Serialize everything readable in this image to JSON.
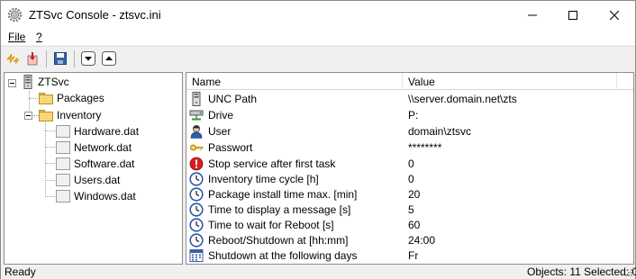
{
  "window": {
    "title": "ZTSvc Console - ztsvc.ini",
    "icon": "gear-cog-icon"
  },
  "menu": {
    "file_label": "File",
    "help_label": "?"
  },
  "toolbar": {
    "buttons": [
      "lightning-icon",
      "import-icon",
      "save-icon",
      "arrow-down-icon",
      "arrow-up-icon"
    ]
  },
  "tree": {
    "root": "ZTSvc",
    "packages": "Packages",
    "inventory": "Inventory",
    "files": [
      "Hardware.dat",
      "Network.dat",
      "Software.dat",
      "Users.dat",
      "Windows.dat"
    ]
  },
  "list": {
    "col_name": "Name",
    "col_value": "Value",
    "rows": [
      {
        "name": "UNC Path",
        "value": "\\\\server.domain.net\\zts",
        "icon": "server-icon"
      },
      {
        "name": "Drive",
        "value": "P:",
        "icon": "network-drive-icon"
      },
      {
        "name": "User",
        "value": "domain\\ztsvc",
        "icon": "user-icon"
      },
      {
        "name": "Passwort",
        "value": "********",
        "icon": "key-icon"
      },
      {
        "name": "Stop service after first task",
        "value": "0",
        "icon": "stop-icon"
      },
      {
        "name": "Inventory time cycle [h]",
        "value": "0",
        "icon": "clock-icon"
      },
      {
        "name": "Package install time max. [min]",
        "value": "20",
        "icon": "clock-icon"
      },
      {
        "name": "Time to display a message [s]",
        "value": "5",
        "icon": "clock-icon"
      },
      {
        "name": "Time to wait for Reboot [s]",
        "value": "60",
        "icon": "clock-icon"
      },
      {
        "name": "Reboot/Shutdown at [hh:mm]",
        "value": "24:00",
        "icon": "clock-icon"
      },
      {
        "name": "Shutdown at the following days",
        "value": "Fr",
        "icon": "calendar-icon"
      }
    ]
  },
  "status": {
    "left": "Ready",
    "right": "Objects: 11 Selected: 0"
  }
}
